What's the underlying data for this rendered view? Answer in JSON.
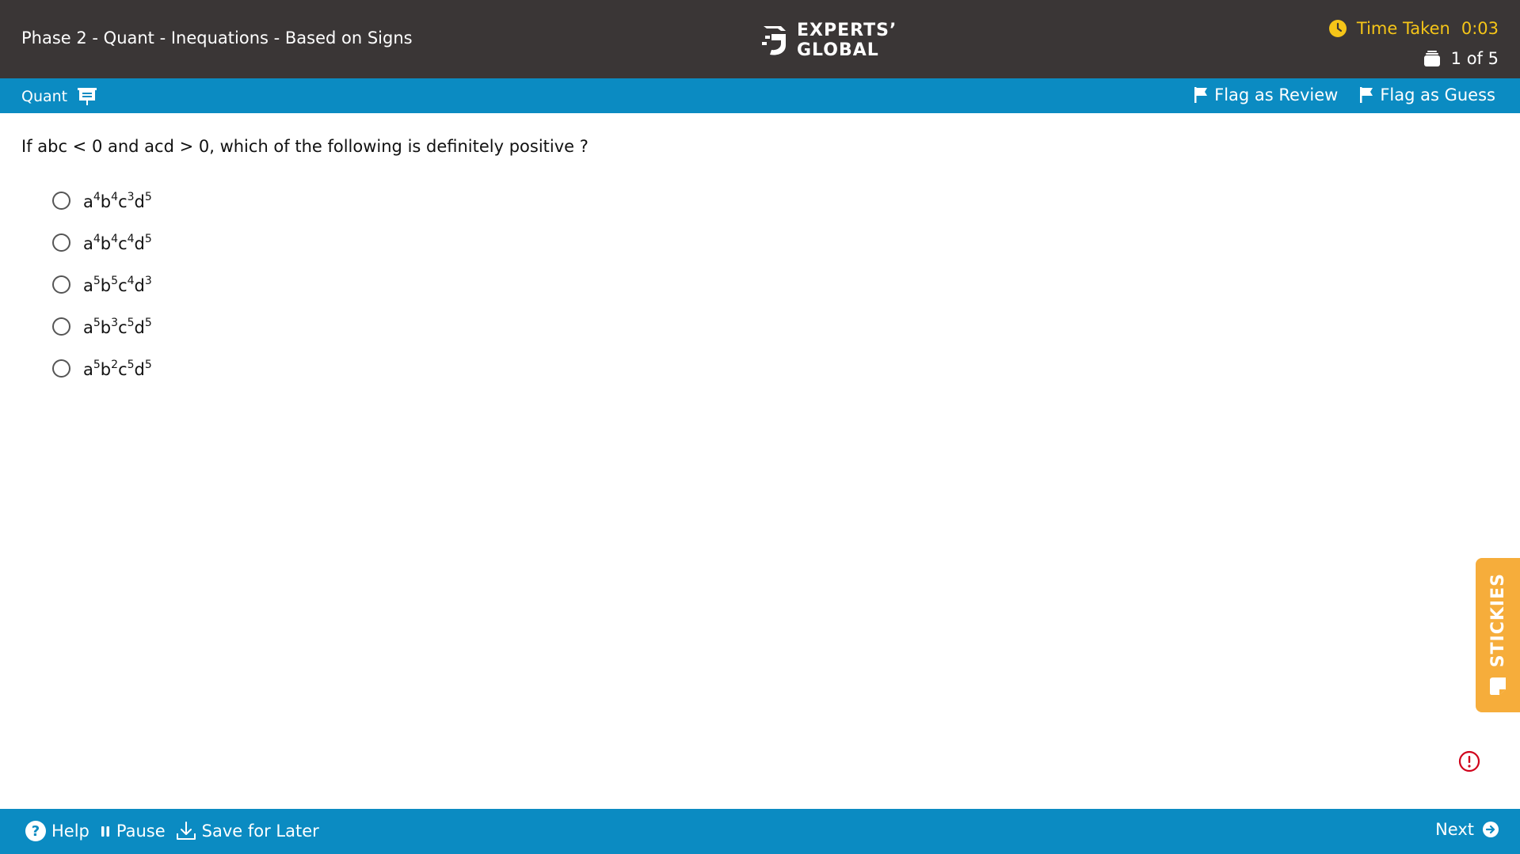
{
  "header": {
    "title": "Phase 2 - Quant - Inequations - Based on Signs",
    "logo_line1": "EXPERTS’",
    "logo_line2": "GLOBAL",
    "timer_label": "Time Taken",
    "timer_value": "0:03",
    "progress": "1 of 5"
  },
  "subbar": {
    "section": "Quant",
    "flag_review": "Flag as Review",
    "flag_guess": "Flag as Guess"
  },
  "question": {
    "text": "If abc < 0 and acd > 0, which of the following is definitely positive ?",
    "options": [
      {
        "a": "4",
        "b": "4",
        "c": "3",
        "d": "5"
      },
      {
        "a": "4",
        "b": "4",
        "c": "4",
        "d": "5"
      },
      {
        "a": "5",
        "b": "5",
        "c": "4",
        "d": "3"
      },
      {
        "a": "5",
        "b": "3",
        "c": "5",
        "d": "5"
      },
      {
        "a": "5",
        "b": "2",
        "c": "5",
        "d": "5"
      }
    ],
    "variables": {
      "a": "a",
      "b": "b",
      "c": "c",
      "d": "d"
    }
  },
  "side": {
    "stickies": "STICKIES"
  },
  "footer": {
    "help": "Help",
    "pause": "Pause",
    "save": "Save for Later",
    "next": "Next"
  },
  "colors": {
    "topbar": "#3a3636",
    "accent": "#0b8bc2",
    "timer": "#f5c518",
    "stickies": "#f6ad3b",
    "alert": "#d0021b"
  }
}
